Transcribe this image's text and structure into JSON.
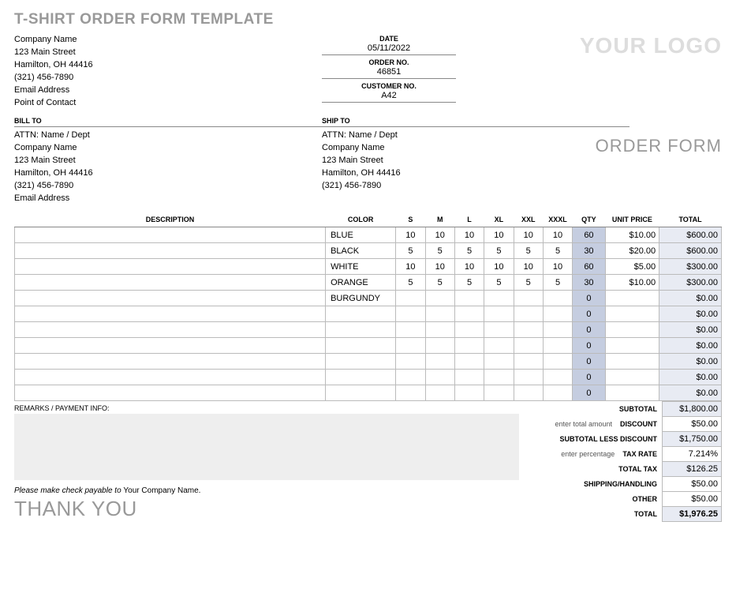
{
  "title": "T-SHIRT ORDER FORM TEMPLATE",
  "logo_text": "YOUR LOGO",
  "order_form_text": "ORDER FORM",
  "company": {
    "name": "Company Name",
    "street": "123 Main Street",
    "city": "Hamilton, OH 44416",
    "phone": "(321) 456-7890",
    "email": "Email Address",
    "contact": "Point of Contact"
  },
  "meta": {
    "date_label": "DATE",
    "date": "05/11/2022",
    "order_no_label": "ORDER NO.",
    "order_no": "46851",
    "customer_no_label": "CUSTOMER NO.",
    "customer_no": "A42"
  },
  "bill_to": {
    "heading": "BILL TO",
    "attn": "ATTN: Name / Dept",
    "company": "Company Name",
    "street": "123 Main Street",
    "city": "Hamilton, OH 44416",
    "phone": "(321) 456-7890",
    "email": "Email Address"
  },
  "ship_to": {
    "heading": "SHIP TO",
    "attn": "ATTN: Name / Dept",
    "company": "Company Name",
    "street": "123 Main Street",
    "city": "Hamilton, OH 44416",
    "phone": "(321) 456-7890"
  },
  "columns": {
    "description": "DESCRIPTION",
    "color": "COLOR",
    "s": "S",
    "m": "M",
    "l": "L",
    "xl": "XL",
    "xxl": "XXL",
    "xxxl": "XXXL",
    "qty": "QTY",
    "unit_price": "UNIT PRICE",
    "total": "TOTAL"
  },
  "rows": [
    {
      "desc": "",
      "color": "BLUE",
      "s": "10",
      "m": "10",
      "l": "10",
      "xl": "10",
      "xxl": "10",
      "xxxl": "10",
      "qty": "60",
      "up": "$10.00",
      "tot": "$600.00"
    },
    {
      "desc": "",
      "color": "BLACK",
      "s": "5",
      "m": "5",
      "l": "5",
      "xl": "5",
      "xxl": "5",
      "xxxl": "5",
      "qty": "30",
      "up": "$20.00",
      "tot": "$600.00"
    },
    {
      "desc": "",
      "color": "WHITE",
      "s": "10",
      "m": "10",
      "l": "10",
      "xl": "10",
      "xxl": "10",
      "xxxl": "10",
      "qty": "60",
      "up": "$5.00",
      "tot": "$300.00"
    },
    {
      "desc": "",
      "color": "ORANGE",
      "s": "5",
      "m": "5",
      "l": "5",
      "xl": "5",
      "xxl": "5",
      "xxxl": "5",
      "qty": "30",
      "up": "$10.00",
      "tot": "$300.00"
    },
    {
      "desc": "",
      "color": "BURGUNDY",
      "s": "",
      "m": "",
      "l": "",
      "xl": "",
      "xxl": "",
      "xxxl": "",
      "qty": "0",
      "up": "",
      "tot": "$0.00"
    },
    {
      "desc": "",
      "color": "",
      "s": "",
      "m": "",
      "l": "",
      "xl": "",
      "xxl": "",
      "xxxl": "",
      "qty": "0",
      "up": "",
      "tot": "$0.00"
    },
    {
      "desc": "",
      "color": "",
      "s": "",
      "m": "",
      "l": "",
      "xl": "",
      "xxl": "",
      "xxxl": "",
      "qty": "0",
      "up": "",
      "tot": "$0.00"
    },
    {
      "desc": "",
      "color": "",
      "s": "",
      "m": "",
      "l": "",
      "xl": "",
      "xxl": "",
      "xxxl": "",
      "qty": "0",
      "up": "",
      "tot": "$0.00"
    },
    {
      "desc": "",
      "color": "",
      "s": "",
      "m": "",
      "l": "",
      "xl": "",
      "xxl": "",
      "xxxl": "",
      "qty": "0",
      "up": "",
      "tot": "$0.00"
    },
    {
      "desc": "",
      "color": "",
      "s": "",
      "m": "",
      "l": "",
      "xl": "",
      "xxl": "",
      "xxxl": "",
      "qty": "0",
      "up": "",
      "tot": "$0.00"
    },
    {
      "desc": "",
      "color": "",
      "s": "",
      "m": "",
      "l": "",
      "xl": "",
      "xxl": "",
      "xxxl": "",
      "qty": "0",
      "up": "",
      "tot": "$0.00"
    }
  ],
  "remarks_label": "REMARKS / PAYMENT INFO:",
  "payable_prefix": "Please make check payable to ",
  "payable_name": "Your Company Name.",
  "thank_you": "THANK YOU",
  "summary": {
    "subtotal": {
      "label": "SUBTOTAL",
      "val": "$1,800.00"
    },
    "discount": {
      "hint": "enter total amount",
      "label": "DISCOUNT",
      "val": "$50.00"
    },
    "sub_less": {
      "label": "SUBTOTAL LESS DISCOUNT",
      "val": "$1,750.00"
    },
    "tax_rate": {
      "hint": "enter percentage",
      "label": "TAX RATE",
      "val": "7.214%"
    },
    "total_tax": {
      "label": "TOTAL TAX",
      "val": "$126.25"
    },
    "shipping": {
      "label": "SHIPPING/HANDLING",
      "val": "$50.00"
    },
    "other": {
      "label": "OTHER",
      "val": "$50.00"
    },
    "total": {
      "label": "TOTAL",
      "val": "$1,976.25"
    }
  }
}
